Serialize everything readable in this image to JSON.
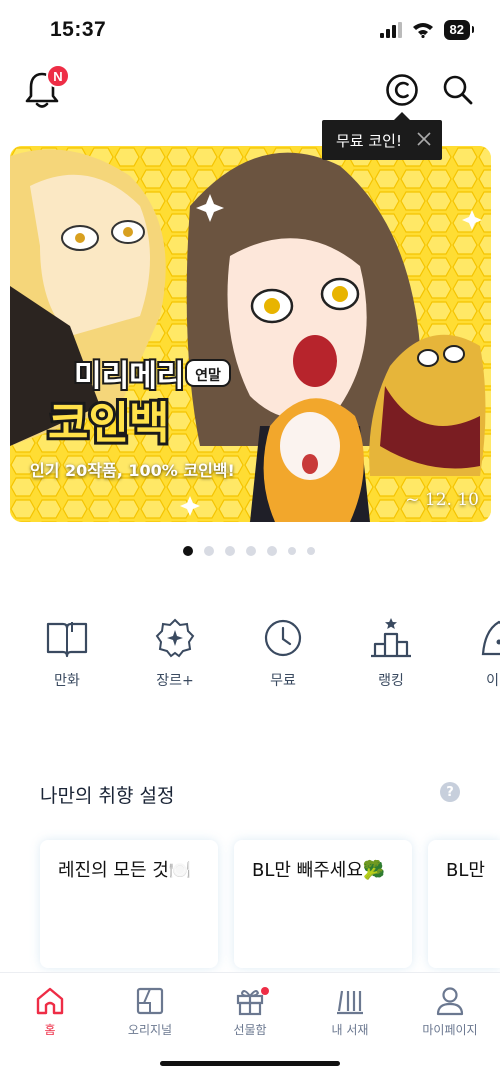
{
  "status": {
    "time": "15:37",
    "battery": "82"
  },
  "header": {
    "notification_badge": "N",
    "coin_tooltip": "무료 코인!"
  },
  "banner": {
    "title_small": "미리메리",
    "title_tag": "연말",
    "title_big": "코인백",
    "subtitle": "인기 20작품, 100% 코인백!",
    "date": "~ 12. 10",
    "page_count": 7,
    "active_index": 0
  },
  "categories": [
    {
      "label": "만화",
      "icon": "book-icon"
    },
    {
      "label": "장르+",
      "icon": "genre-badge-icon"
    },
    {
      "label": "무료",
      "icon": "clock-icon"
    },
    {
      "label": "랭킹",
      "icon": "podium-icon"
    },
    {
      "label": "이벤",
      "icon": "event-icon"
    }
  ],
  "preferences": {
    "title": "나만의 취향 설정",
    "help": "?",
    "cards": [
      {
        "label": "레진의 모든 것🍽️"
      },
      {
        "label": "BL만 빼주세요🥦"
      },
      {
        "label": "BL만"
      }
    ]
  },
  "bottom_nav": [
    {
      "label": "홈",
      "icon": "home-icon",
      "active": true
    },
    {
      "label": "오리지널",
      "icon": "originals-icon",
      "active": false
    },
    {
      "label": "선물함",
      "icon": "gift-icon",
      "active": false
    },
    {
      "label": "내 서재",
      "icon": "library-icon",
      "active": false
    },
    {
      "label": "마이페이지",
      "icon": "profile-icon",
      "active": false
    }
  ],
  "colors": {
    "accent": "#ee2d46",
    "banner_bg": "#ffe14a",
    "icon": "#3a4a60"
  }
}
